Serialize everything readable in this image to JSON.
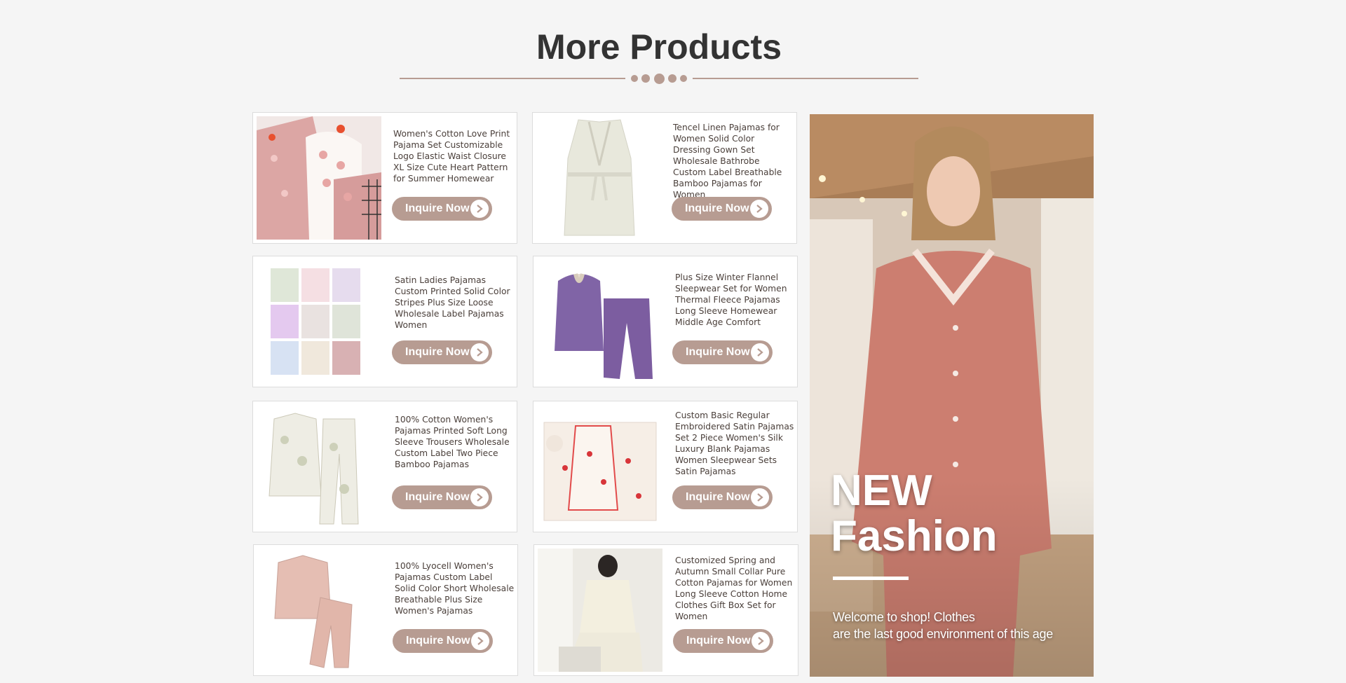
{
  "section": {
    "title": "More Products"
  },
  "products": [
    {
      "name": "Women's Cotton Love Print Pajama Set Customizable Logo Elastic Waist Closure XL Size Cute Heart Pattern for Summer Homewear",
      "button": "Inquire Now"
    },
    {
      "name": "Tencel Linen Pajamas for Women Solid Color Dressing Gown Set Wholesale Bathrobe Custom Label Breathable Bamboo Pajamas for Women",
      "button": "Inquire Now"
    },
    {
      "name": "Satin Ladies Pajamas Custom Printed Solid Color Stripes Plus Size Loose Wholesale Label Pajamas Women",
      "button": "Inquire Now"
    },
    {
      "name": "Plus Size Winter Flannel Sleepwear Set for Women Thermal Fleece Pajamas Long Sleeve Homewear Middle Age Comfort",
      "button": "Inquire Now"
    },
    {
      "name": "100% Cotton Women's Pajamas Printed Soft Long Sleeve Trousers Wholesale Custom Label Two Piece Bamboo Pajamas",
      "button": "Inquire Now"
    },
    {
      "name": "Custom Basic Regular Embroidered Satin Pajamas Set 2 Piece Women's Silk Luxury Blank Pajamas Women Sleepwear Sets Satin Pajamas",
      "button": "Inquire Now"
    },
    {
      "name": "100% Lyocell Women's Pajamas Custom Label Solid Color Short Wholesale Breathable Plus Size Women's Pajamas",
      "button": "Inquire Now"
    },
    {
      "name": "Customized Spring and Autumn Small Collar Pure Cotton Pajamas for Women Long Sleeve Cotton Home Clothes Gift Box Set for Women",
      "button": "Inquire Now"
    }
  ],
  "banner": {
    "line1": "NEW",
    "line2": "Fashion",
    "tagline1": "Welcome to shop! Clothes",
    "tagline2": "are the last good environment of this age"
  },
  "colors": {
    "accent": "#b79c92",
    "text": "#333333"
  }
}
